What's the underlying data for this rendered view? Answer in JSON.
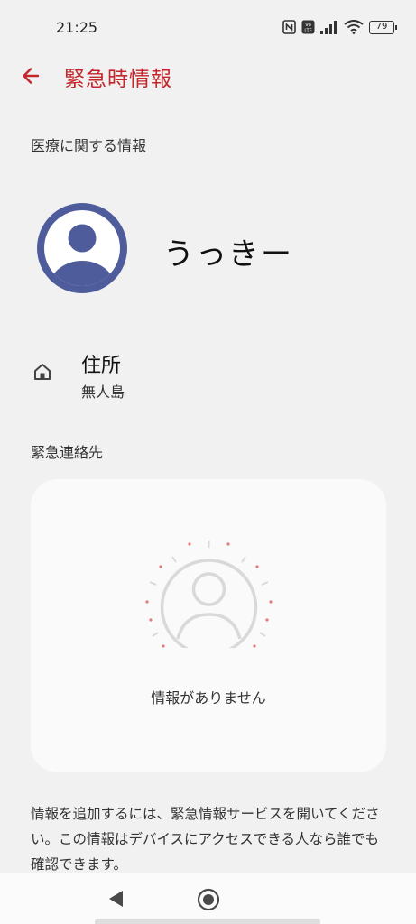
{
  "status_bar": {
    "time": "21:25",
    "icons": [
      "nfc-icon",
      "volte-icon",
      "signal-icon",
      "wifi-icon",
      "battery-icon"
    ],
    "volte_label": "Vo LTE",
    "battery_level": "79"
  },
  "app_bar": {
    "back_icon": "arrow-left-icon",
    "title": "緊急時情報"
  },
  "colors": {
    "accent": "#c3262b",
    "avatar": "#4f5c9c",
    "background": "#f1f1f1",
    "card": "#fafafa"
  },
  "medical": {
    "section_label": "医療に関する情報",
    "name": "うっきー",
    "address_icon": "home-icon",
    "address_label": "住所",
    "address_value": "無人島"
  },
  "contacts": {
    "section_label": "緊急連絡先",
    "empty_text": "情報がありません"
  },
  "footer_info": "情報を追加するには、緊急情報サービスを開いてください。この情報はデバイスにアクセスできる人なら誰でも確認できます。",
  "nav_bar": {
    "icons": [
      "back-triangle-icon",
      "home-circle-icon"
    ]
  }
}
